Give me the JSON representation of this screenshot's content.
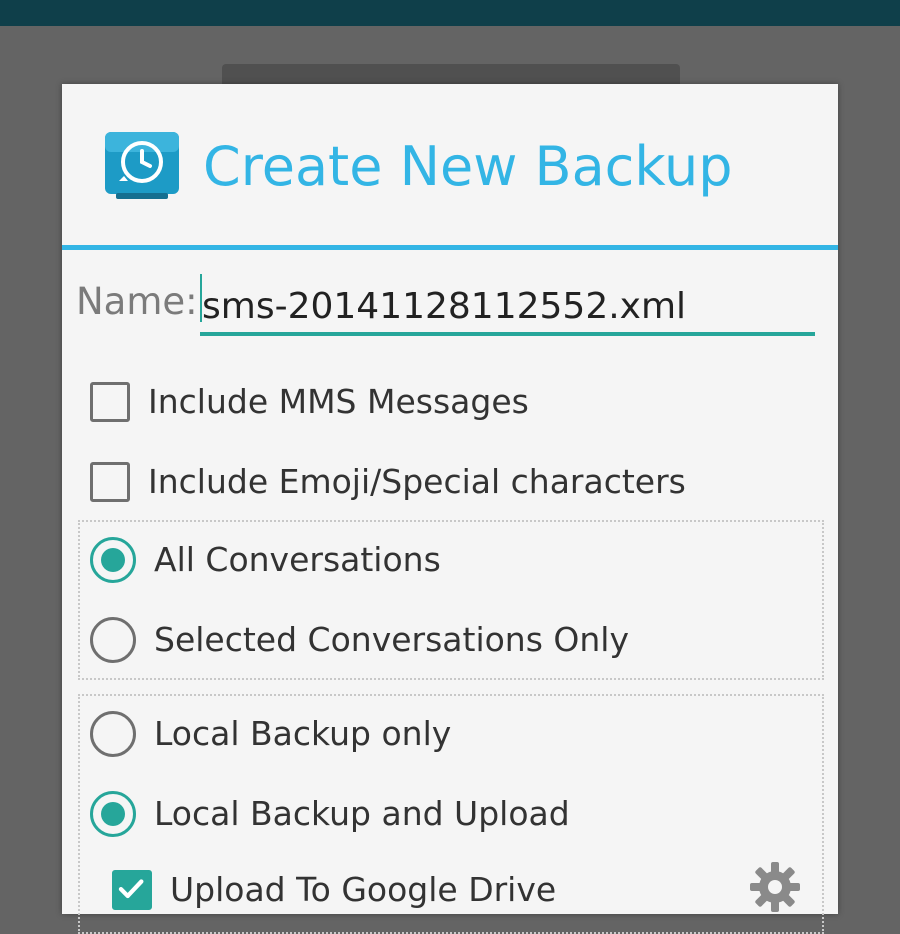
{
  "dialog": {
    "title": "Create New Backup",
    "app_icon": "backup-clock-icon",
    "accent_color": "#33b5e5",
    "control_color": "#26a69a"
  },
  "name_field": {
    "label": "Name:",
    "value": "sms-20141128112552.xml"
  },
  "options": {
    "include_mms": {
      "label": "Include MMS Messages",
      "checked": false
    },
    "include_emoji": {
      "label": "Include Emoji/Special characters",
      "checked": false
    }
  },
  "conversations": {
    "all": {
      "label": "All Conversations",
      "selected": true
    },
    "selected_only": {
      "label": "Selected Conversations Only",
      "selected": false
    }
  },
  "backup_location": {
    "local_only": {
      "label": "Local Backup only",
      "selected": false
    },
    "local_and_upload": {
      "label": "Local Backup and Upload",
      "selected": true
    },
    "google_drive": {
      "label": "Upload To Google Drive",
      "checked": true,
      "settings_icon": "gear-icon"
    }
  }
}
